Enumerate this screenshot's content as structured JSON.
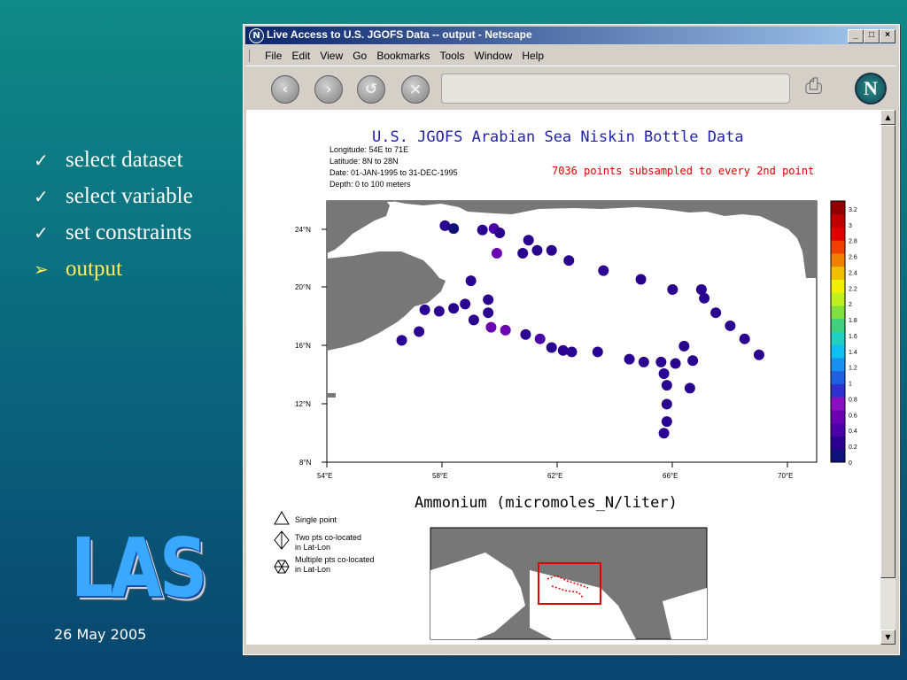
{
  "slide": {
    "items": [
      {
        "mark": "✓",
        "label": "select dataset"
      },
      {
        "mark": "✓",
        "label": "select variable"
      },
      {
        "mark": "✓",
        "label": "set constraints"
      },
      {
        "mark": "➢",
        "label": "output"
      }
    ],
    "logo_text": "LAS",
    "date": "26 May 2005"
  },
  "window": {
    "title": "Live Access to U.S. JGOFS Data -- output - Netscape",
    "controls": {
      "minimize": "_",
      "maximize": "□",
      "close": "×"
    },
    "menu": [
      "File",
      "Edit",
      "View",
      "Go",
      "Bookmarks",
      "Tools",
      "Window",
      "Help"
    ],
    "nav_icons": [
      "back-icon",
      "forward-icon",
      "reload-icon",
      "stop-icon"
    ],
    "url": ""
  },
  "plot": {
    "title": "U.S. JGOFS Arabian Sea Niskin Bottle Data",
    "meta": [
      "Longitude: 54E to 71E",
      "Latitude: 8N to 28N",
      "Date: 01-JAN-1995 to 31-DEC-1995",
      "Depth: 0 to 100 meters"
    ],
    "subsample_note": "7036 points subsampled to every 2nd point",
    "variable_label": "Ammonium (micromoles_N/liter)",
    "legend": [
      {
        "symbol": "triangle",
        "lines": [
          "Single point"
        ]
      },
      {
        "symbol": "diamond",
        "lines": [
          "Two pts co-located",
          "in Lat-Lon"
        ]
      },
      {
        "symbol": "hexagon",
        "lines": [
          "Multiple pts co-located",
          "in Lat-Lon"
        ]
      }
    ]
  },
  "chart_data": {
    "type": "scatter",
    "title": "U.S. JGOFS Arabian Sea Niskin Bottle Data",
    "xlabel": "",
    "ylabel": "",
    "colorbar_label": "Ammonium (micromoles_N/liter)",
    "x_ticks": [
      "54°E",
      "58°E",
      "62°E",
      "66°E",
      "70°E"
    ],
    "y_ticks": [
      "8°N",
      "12°N",
      "16°N",
      "20°N",
      "24°N"
    ],
    "xlim": [
      54,
      71
    ],
    "ylim": [
      8,
      26
    ],
    "colorbar_ticks": [
      "0",
      "0.2",
      "0.4",
      "0.6",
      "0.8",
      "1",
      "1.2",
      "1.4",
      "1.6",
      "1.8",
      "2",
      "2.2",
      "2.4",
      "2.6",
      "2.8",
      "3",
      "3.2"
    ],
    "colorbar_range": [
      0,
      3.3
    ],
    "points": [
      {
        "lon": 58.1,
        "lat": 24.3,
        "value": 0.2
      },
      {
        "lon": 58.4,
        "lat": 24.1,
        "value": 0.1
      },
      {
        "lon": 59.4,
        "lat": 24.0,
        "value": 0.3
      },
      {
        "lon": 59.8,
        "lat": 24.1,
        "value": 0.4
      },
      {
        "lon": 60.0,
        "lat": 23.8,
        "value": 0.2
      },
      {
        "lon": 61.0,
        "lat": 23.3,
        "value": 0.3
      },
      {
        "lon": 61.3,
        "lat": 22.6,
        "value": 0.2
      },
      {
        "lon": 61.8,
        "lat": 22.6,
        "value": 0.2
      },
      {
        "lon": 59.9,
        "lat": 22.4,
        "value": 0.5
      },
      {
        "lon": 60.8,
        "lat": 22.4,
        "value": 0.2
      },
      {
        "lon": 62.4,
        "lat": 21.9,
        "value": 0.3
      },
      {
        "lon": 63.6,
        "lat": 21.2,
        "value": 0.2
      },
      {
        "lon": 64.9,
        "lat": 20.6,
        "value": 0.2
      },
      {
        "lon": 66.0,
        "lat": 19.9,
        "value": 0.2
      },
      {
        "lon": 67.0,
        "lat": 19.9,
        "value": 0.3
      },
      {
        "lon": 67.1,
        "lat": 19.3,
        "value": 0.2
      },
      {
        "lon": 67.5,
        "lat": 18.3,
        "value": 0.2
      },
      {
        "lon": 68.0,
        "lat": 17.4,
        "value": 0.2
      },
      {
        "lon": 68.5,
        "lat": 16.5,
        "value": 0.2
      },
      {
        "lon": 69.0,
        "lat": 15.4,
        "value": 0.2
      },
      {
        "lon": 66.4,
        "lat": 16.0,
        "value": 0.2
      },
      {
        "lon": 66.7,
        "lat": 15.0,
        "value": 0.2
      },
      {
        "lon": 59.0,
        "lat": 20.5,
        "value": 0.2
      },
      {
        "lon": 59.6,
        "lat": 19.2,
        "value": 0.2
      },
      {
        "lon": 59.6,
        "lat": 18.3,
        "value": 0.2
      },
      {
        "lon": 58.8,
        "lat": 18.9,
        "value": 0.3
      },
      {
        "lon": 58.4,
        "lat": 18.6,
        "value": 0.2
      },
      {
        "lon": 57.9,
        "lat": 18.4,
        "value": 0.2
      },
      {
        "lon": 57.4,
        "lat": 18.5,
        "value": 0.2
      },
      {
        "lon": 57.2,
        "lat": 17.0,
        "value": 0.2
      },
      {
        "lon": 56.6,
        "lat": 16.4,
        "value": 0.3
      },
      {
        "lon": 59.1,
        "lat": 17.8,
        "value": 0.2
      },
      {
        "lon": 59.7,
        "lat": 17.3,
        "value": 0.5
      },
      {
        "lon": 60.2,
        "lat": 17.1,
        "value": 0.6
      },
      {
        "lon": 60.9,
        "lat": 16.8,
        "value": 0.2
      },
      {
        "lon": 61.4,
        "lat": 16.5,
        "value": 0.4
      },
      {
        "lon": 61.8,
        "lat": 15.9,
        "value": 0.3
      },
      {
        "lon": 62.2,
        "lat": 15.7,
        "value": 0.2
      },
      {
        "lon": 62.5,
        "lat": 15.6,
        "value": 0.2
      },
      {
        "lon": 63.4,
        "lat": 15.6,
        "value": 0.2
      },
      {
        "lon": 64.5,
        "lat": 15.1,
        "value": 0.2
      },
      {
        "lon": 65.0,
        "lat": 14.9,
        "value": 0.2
      },
      {
        "lon": 65.6,
        "lat": 14.9,
        "value": 0.2
      },
      {
        "lon": 66.1,
        "lat": 14.8,
        "value": 0.2
      },
      {
        "lon": 65.7,
        "lat": 14.1,
        "value": 0.3
      },
      {
        "lon": 65.8,
        "lat": 13.3,
        "value": 0.2
      },
      {
        "lon": 66.6,
        "lat": 13.1,
        "value": 0.2
      },
      {
        "lon": 65.8,
        "lat": 12.0,
        "value": 0.2
      },
      {
        "lon": 65.8,
        "lat": 10.8,
        "value": 0.2
      },
      {
        "lon": 65.7,
        "lat": 10.0,
        "value": 0.2
      }
    ]
  }
}
